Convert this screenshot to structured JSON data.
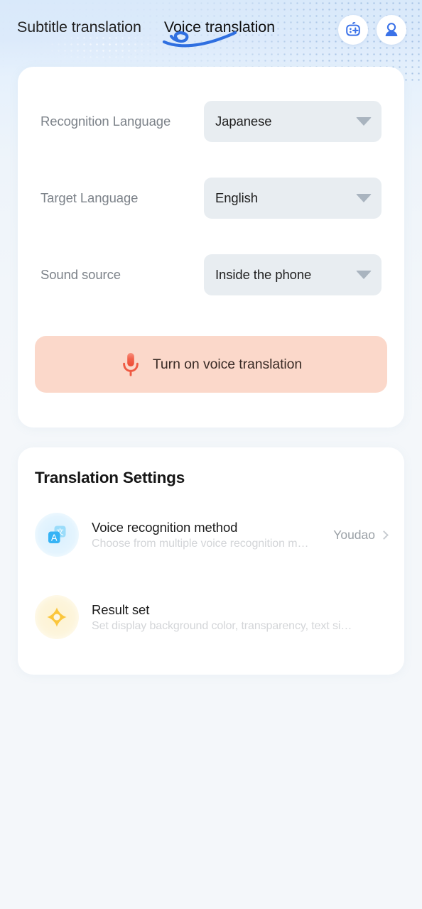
{
  "header": {
    "tabs": [
      {
        "label": "Subtitle translation",
        "active": false
      },
      {
        "label": "Voice translation",
        "active": true
      }
    ],
    "actions": [
      {
        "name": "robot-assistant-icon",
        "label": "Assistant"
      },
      {
        "name": "user-profile-icon",
        "label": "Profile"
      }
    ]
  },
  "main_card": {
    "rows": [
      {
        "label": "Recognition Language",
        "value": "Japanese"
      },
      {
        "label": "Target Language",
        "value": "English"
      },
      {
        "label": "Sound source",
        "value": "Inside the phone"
      }
    ],
    "mic_button": {
      "label": "Turn on voice translation",
      "icon": "microphone-icon"
    }
  },
  "settings_card": {
    "title": "Translation Settings",
    "items": [
      {
        "icon": "translate-icon",
        "title": "Voice recognition method",
        "subtitle": "Choose from multiple voice recognition m…",
        "value": "Youdao",
        "chevron": "chevron-right-icon"
      },
      {
        "icon": "result-set-icon",
        "title": "Result set",
        "subtitle": "Set display background color, transparency, text si…",
        "value": "",
        "chevron": ""
      }
    ]
  },
  "colors": {
    "accent_blue": "#3b72e8",
    "header_bg_top": "#d9e9fa",
    "page_bg": "#f4f7fa",
    "select_bg": "#e8edf1",
    "mic_button_bg": "#fbd8ca",
    "mic_icon": "#f05a45",
    "translate_icon": "#3fb0f5",
    "result_icon": "#fbc83f",
    "label_gray": "#7c8289",
    "subtitle_gray": "#d3d5d8"
  }
}
